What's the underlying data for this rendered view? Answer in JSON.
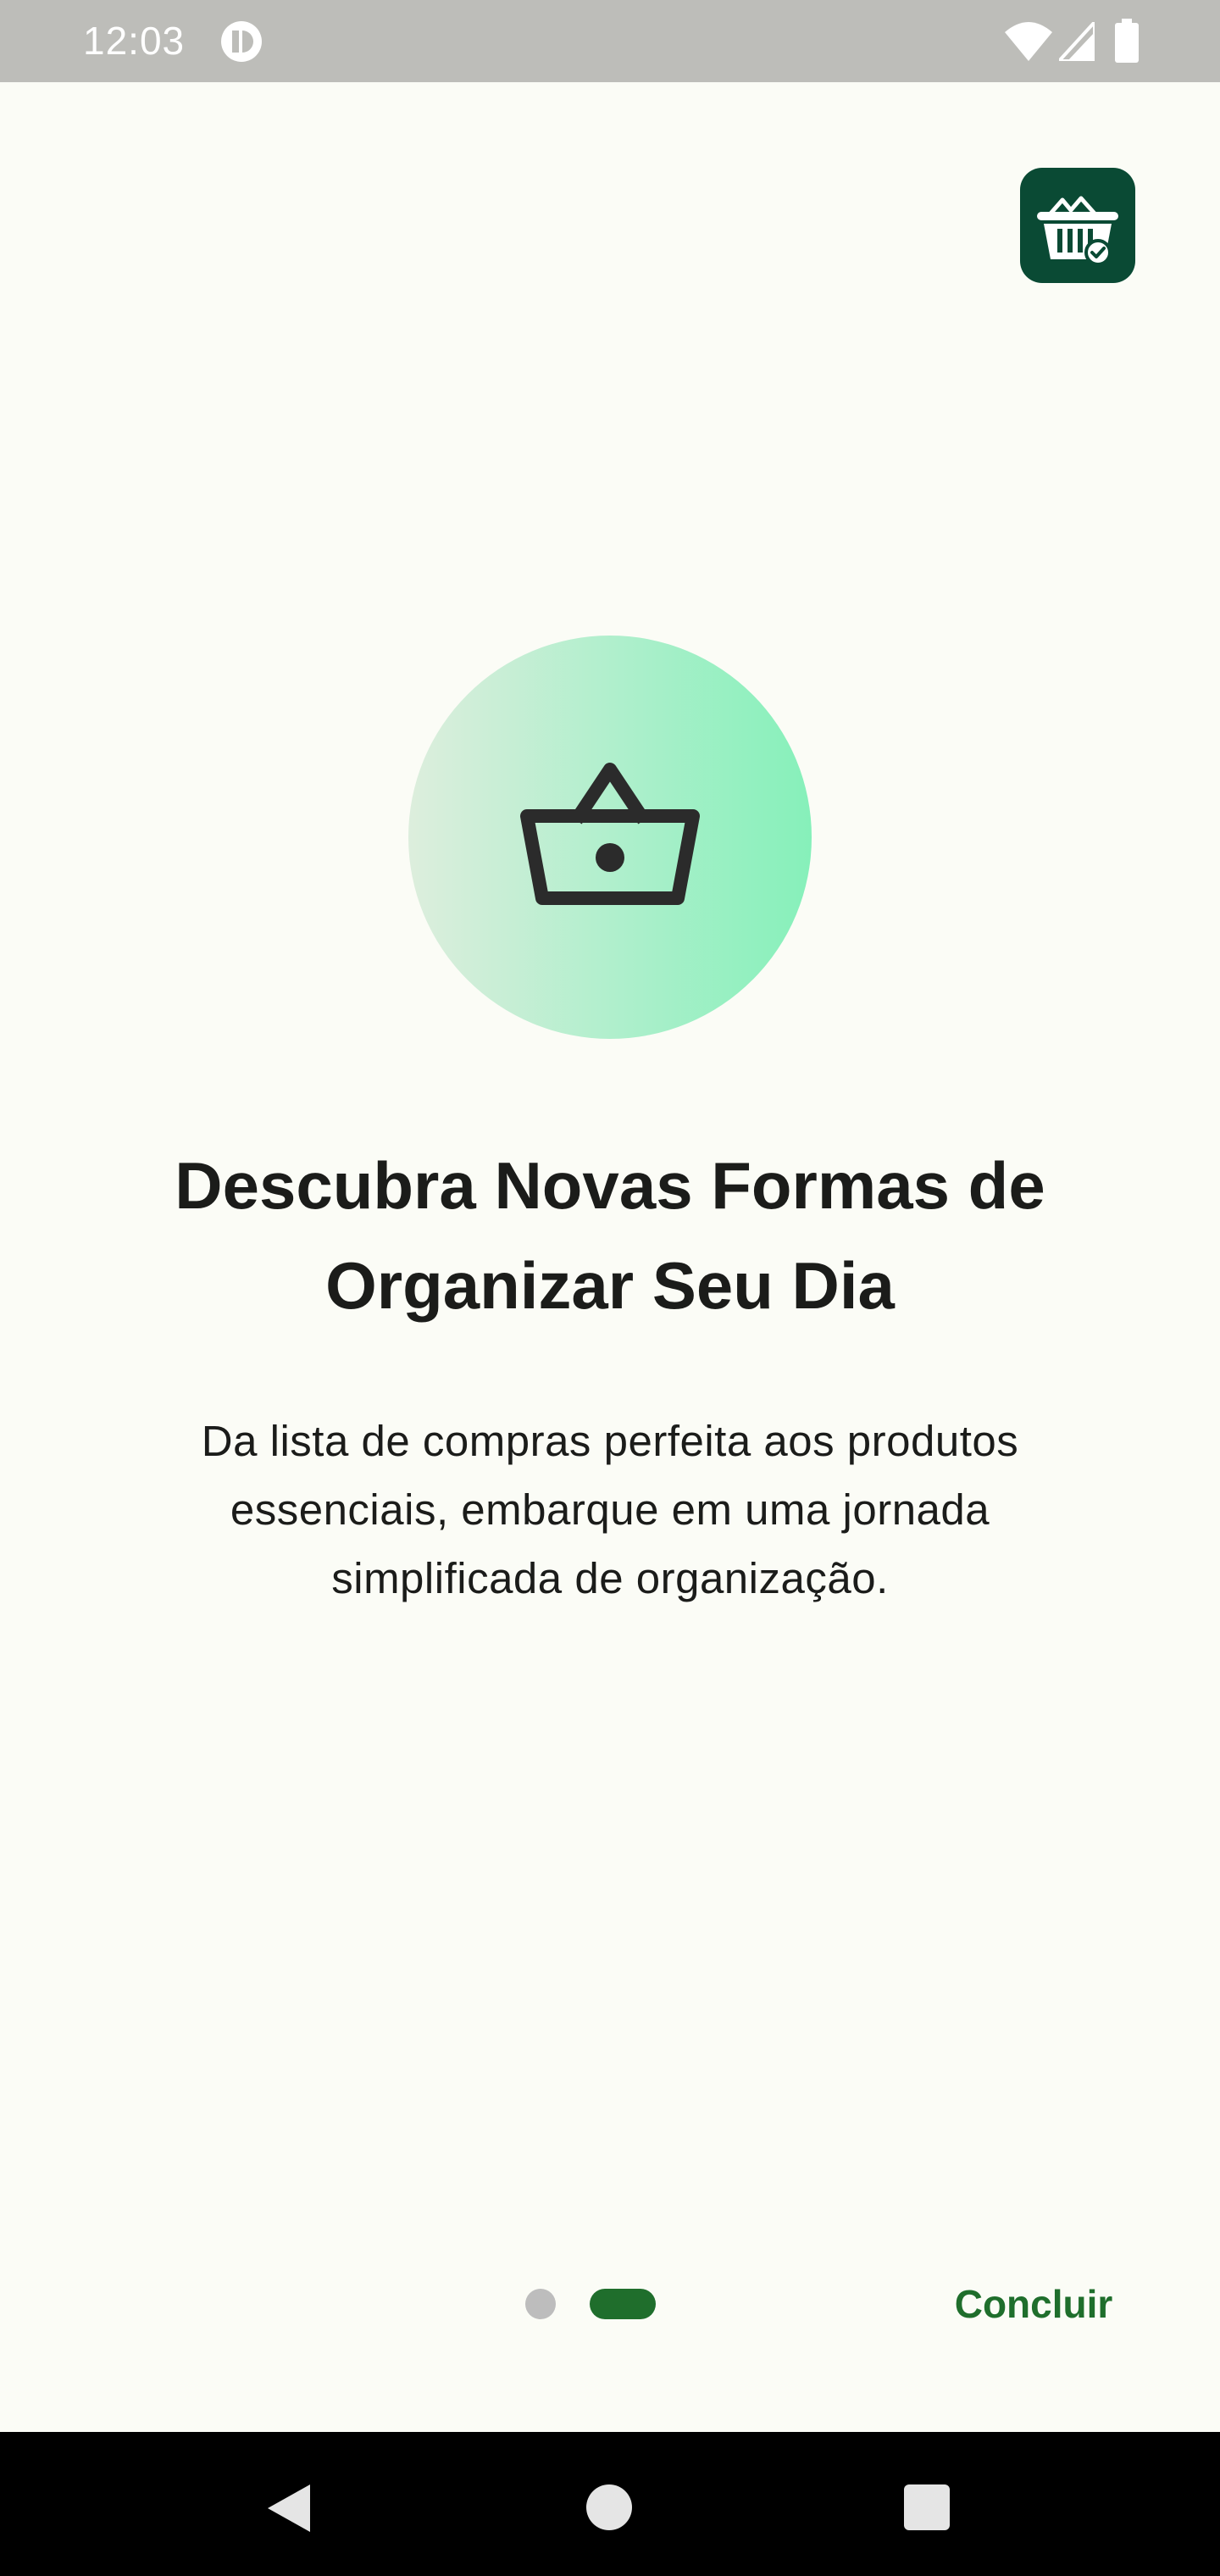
{
  "status_bar": {
    "time": "12:03",
    "icons": [
      "app-notification-icon",
      "wifi-icon",
      "signal-icon",
      "battery-icon"
    ]
  },
  "app_logo": {
    "icon": "shopping-basket-check-icon",
    "color": "#0A4A34"
  },
  "hero": {
    "icon": "shopping-basket-icon"
  },
  "title": "Descubra Novas Formas de Organizar Seu Dia",
  "subtitle": "Da lista de compras perfeita aos produtos essenciais, embarque em uma jornada simplificada de organização.",
  "pager": {
    "total": 2,
    "current": 2
  },
  "finish_button": {
    "label": "Concluir"
  },
  "colors": {
    "background": "#FBFCF6",
    "accent": "#1F6E2C",
    "text": "#1B1C1A"
  },
  "nav_bar": {
    "buttons": [
      "back",
      "home",
      "recents"
    ]
  }
}
